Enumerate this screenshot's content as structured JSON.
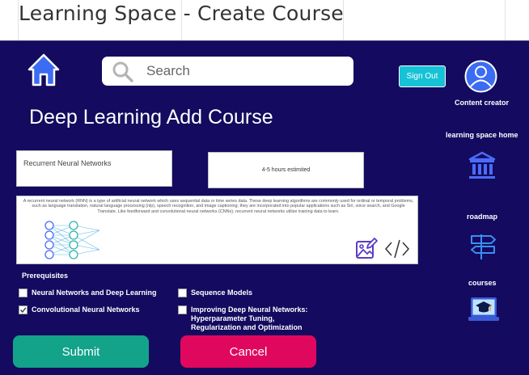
{
  "window": {
    "title": "Learning Space - Create Course"
  },
  "header": {
    "search_placeholder": "Search",
    "sign_out_label": "Sign Out"
  },
  "sidebar": {
    "profile_label": "Content creator",
    "home_label": "learning space home",
    "roadmap_label": "roadmap",
    "courses_label": "courses"
  },
  "main": {
    "page_title": "Deep Learning Add Course",
    "course_name": "Recurrent Neural Networks",
    "duration": "4-5 hours estimited",
    "description": "A recurrent neural network (RNN) is a type of artificial neural network which uses sequential data or time series data. These deep learning algorithms are commonly used for ordinal or temporal problems, such as language translation, natural language processing (nlp), speech recognition, and image captioning; they are incorporated into popular applications such as Siri, voice search, and Google Translate. Like feedforward and convolutional neural networks (CNNs), recurrent neural networks utilize training data to learn.",
    "prerequisites_title": "Prerequisites",
    "prerequisites": [
      {
        "label": "Neural Networks and Deep Learning",
        "checked": false
      },
      {
        "label": "Convolutional Neural Networks",
        "checked": true
      },
      {
        "label": "Sequence Models",
        "checked": false
      },
      {
        "label": "Improving Deep Neural Networks: Hyperparameter Tuning, Regularization and Optimization",
        "checked": false
      }
    ],
    "submit_label": "Submit",
    "cancel_label": "Cancel"
  },
  "colors": {
    "background": "#140a5f",
    "accent": "#16c2d5",
    "submit": "#12a38a",
    "cancel": "#e0085e",
    "icon_blue": "#3b6cf2"
  }
}
